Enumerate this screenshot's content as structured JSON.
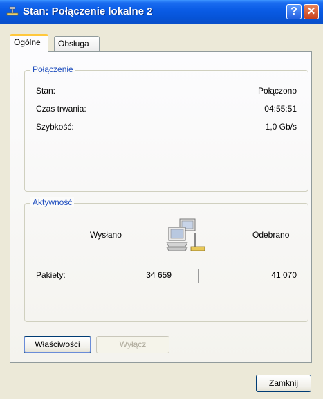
{
  "window": {
    "title": "Stan: Połączenie lokalne 2",
    "help_label": "?",
    "close_label": "✕"
  },
  "tabs": [
    {
      "label": "Ogólne",
      "active": true
    },
    {
      "label": "Obsługa",
      "active": false
    }
  ],
  "connection": {
    "legend": "Połączenie",
    "rows": [
      {
        "label": "Stan:",
        "value": "Połączono"
      },
      {
        "label": "Czas trwania:",
        "value": "04:55:51"
      },
      {
        "label": "Szybkość:",
        "value": "1,0 Gb/s"
      }
    ]
  },
  "activity": {
    "legend": "Aktywność",
    "sent_label": "Wysłano",
    "received_label": "Odebrano",
    "packets_label": "Pakiety:",
    "packets_sent": "34 659",
    "packets_received": "41 070"
  },
  "buttons": {
    "properties": "Właściwości",
    "disable": "Wyłącz",
    "close": "Zamknij"
  },
  "colors": {
    "titlebar": "#0a5ce6",
    "legend_text": "#1f4ebf",
    "active_tab_accent": "#ffc83c"
  },
  "icons": {
    "title": "network-connection-icon",
    "activity": "computers-network-icon"
  }
}
